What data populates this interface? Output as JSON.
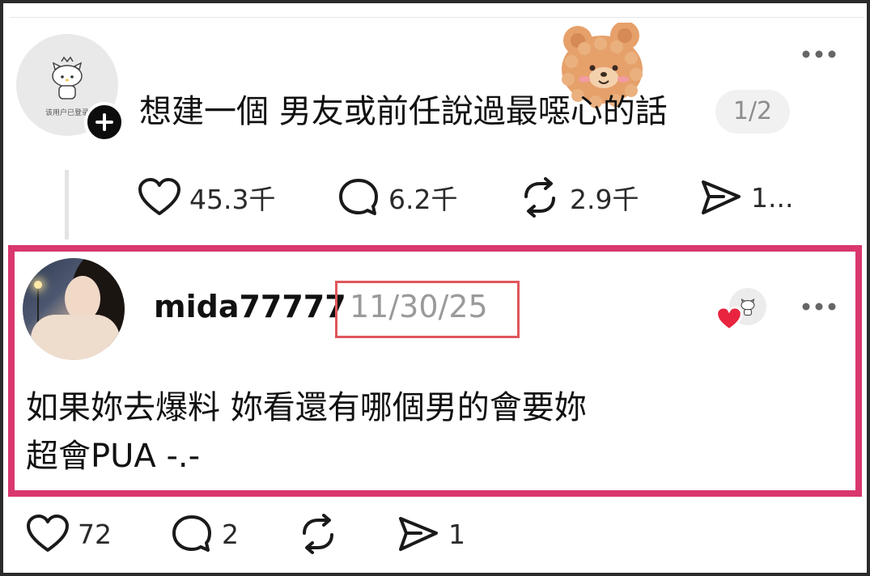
{
  "thread_post": {
    "avatar_caption": "该用户已登录",
    "text": "想建一個 男友或前任說過最噁心的話",
    "page_indicator": "1/2",
    "actions": {
      "likes": "45.3千",
      "comments": "6.2千",
      "reposts": "2.9千",
      "shares": "1..."
    }
  },
  "reply": {
    "username": "mida77777",
    "date": "11/30/25",
    "text_line_1": "如果妳去爆料 妳看還有哪個男的會要妳",
    "text_line_2": "超會PUA -.-",
    "actions": {
      "likes": "72",
      "comments": "2",
      "reposts": "",
      "shares": "1"
    }
  },
  "colors": {
    "highlight_border": "#d9376e",
    "date_box_border": "#e0575b",
    "liked_heart": "#e8243f",
    "muted_text": "#9a9a9a"
  },
  "icons": [
    "heart-icon",
    "comment-icon",
    "repost-icon",
    "share-icon",
    "more-icon",
    "plus-icon",
    "bear-sticker-icon"
  ]
}
